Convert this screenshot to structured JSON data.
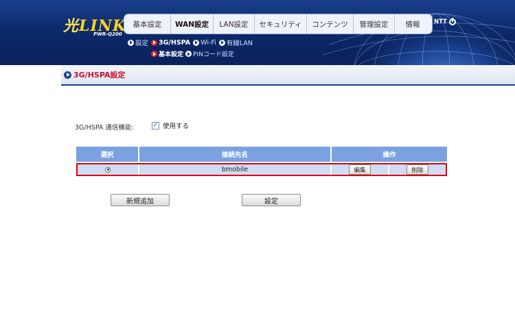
{
  "header": {
    "logo_text": "LINK",
    "logo_mark": "光",
    "model": "PWR-Q200",
    "brand": "NTT"
  },
  "nav": {
    "items": [
      "基本設定",
      "WAN設定",
      "LAN設定",
      "セキュリティ",
      "コンテンツ",
      "管理設定",
      "情報"
    ],
    "active": "WAN設定"
  },
  "subnav": {
    "items": [
      "設定",
      "3G/HSPA",
      "Wi-Fi",
      "有線LAN"
    ],
    "active": "3G/HSPA"
  },
  "subnav2": {
    "items": [
      "基本設定",
      "PINコード設定"
    ],
    "active": "基本設定"
  },
  "page": {
    "title": "3G/HSPA設定",
    "function_label": "3G/HSPA 通信機能:",
    "use_label": "使用する",
    "use_checked": "✓"
  },
  "table": {
    "headers": [
      "選択",
      "接続先名",
      "操作"
    ],
    "rows": [
      {
        "name": "bmobile",
        "edit": "編集",
        "delete": "削除"
      }
    ]
  },
  "buttons": {
    "add": "新規追加",
    "apply": "設定"
  },
  "colors": {
    "header_bg": "#0d2a6b",
    "title_red": "#c8102e",
    "table_header": "#7aa2e0",
    "row_bg": "#cfdcf5",
    "highlight": "#e00000"
  }
}
